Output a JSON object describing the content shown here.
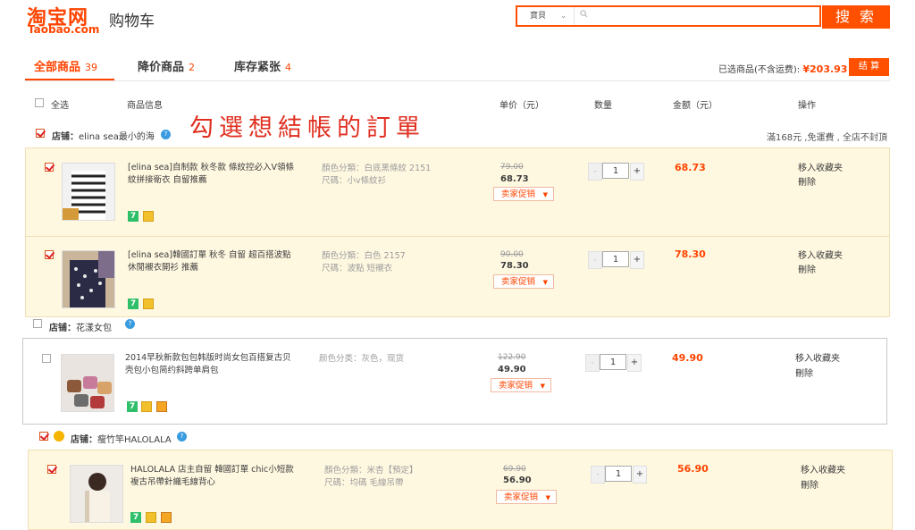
{
  "header": {
    "logo_cn": "淘宝网",
    "logo_en": "Taobao.com",
    "title": "购物车",
    "search": {
      "type_value": "寶貝",
      "placeholder": "",
      "button_label": "搜 索"
    }
  },
  "tabs": [
    {
      "label": "全部商品",
      "count": "39"
    },
    {
      "label": "降价商品",
      "count": "2"
    },
    {
      "label": "库存紧张",
      "count": "4"
    }
  ],
  "summary": {
    "label": "已选商品(不含运费):",
    "amount": "¥203.93",
    "checkout_label": "结 算"
  },
  "columns": {
    "select_all": "全选",
    "info": "商品信息",
    "price": "单价（元）",
    "qty": "数量",
    "amount": "金额（元）",
    "ops": "操作"
  },
  "annotation": "勾選想結帳的訂單",
  "shops": [
    {
      "label": "店铺：",
      "name": "elina sea最小的海",
      "notice": "滿168元 ,免運費 , 全店不封頂",
      "checked": true
    },
    {
      "label": "店铺：",
      "name": "花漾女包",
      "checked": false
    },
    {
      "label": "店铺：",
      "name": "瘦竹竿HALOLALA",
      "checked": true
    }
  ],
  "items": [
    {
      "title": "[elina sea]自制款 秋冬款 條紋控必入V領條紋拼接衛衣 自留推薦",
      "sku1": "顏色分類：白底黑條紋 2151",
      "sku2": "尺碼：小v條紋衫",
      "orig": "79.00",
      "price": "68.73",
      "promo": "卖家促销",
      "qty": "1",
      "amount": "68.73",
      "op1": "移入收藏夹",
      "op2": "刪除"
    },
    {
      "title": "[elina sea]韓國訂單 秋冬 自留 超百搭波點休閒襯衣開衫 推薦",
      "sku1": "顏色分類：白色 2157",
      "sku2": "尺碼：波點 短襯衣",
      "orig": "90.00",
      "price": "78.30",
      "promo": "卖家促销",
      "qty": "1",
      "amount": "78.30",
      "op1": "移入收藏夹",
      "op2": "刪除"
    },
    {
      "title": "2014早秋新款包包韩版时尚女包百搭复古贝壳包小包简约斜跨单肩包",
      "sku1": "颜色分类：灰色，现货",
      "sku2": "",
      "orig": "122.90",
      "price": "49.90",
      "promo": "卖家促销",
      "qty": "1",
      "amount": "49.90",
      "op1": "移入收藏夹",
      "op2": "刪除"
    },
    {
      "title": "HALOLALA 店主自留 韓國訂單 chic小短款複古吊帶針織毛線背心",
      "sku1": "顏色分類：米杏【預定】",
      "sku2": "尺碼：均碼 毛線吊帶",
      "orig": "69.90",
      "price": "56.90",
      "promo": "卖家促销",
      "qty": "1",
      "amount": "56.90",
      "op1": "移入收藏夹",
      "op2": "刪除"
    }
  ]
}
